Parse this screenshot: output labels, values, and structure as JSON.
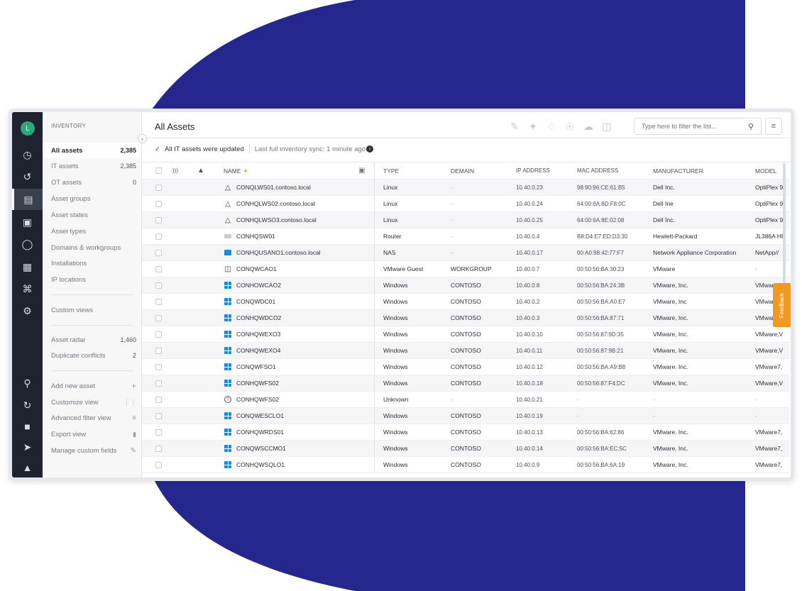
{
  "user": {
    "avatar_letter": "L"
  },
  "sidebar": {
    "title": "INVENTORY",
    "items": [
      {
        "label": "All assets",
        "count": "2,385",
        "active": true
      },
      {
        "label": "IT assets",
        "count": "2,385"
      },
      {
        "label": "OT assets",
        "count": "0"
      },
      {
        "label": "Asset groups",
        "count": ""
      },
      {
        "label": "Asset states",
        "count": ""
      },
      {
        "label": "Asset types",
        "count": ""
      },
      {
        "label": "Domains & workgroups",
        "count": ""
      },
      {
        "label": "Installations",
        "count": ""
      },
      {
        "label": "IP locations",
        "count": ""
      }
    ],
    "custom_views_label": "Custom views",
    "asset_radar": {
      "label": "Asset radar",
      "count": "1,460"
    },
    "duplicate_conflicts": {
      "label": "Duplicate conflicts",
      "count": "2"
    },
    "actions": [
      {
        "label": "Add new asset",
        "icon": "plus-icon"
      },
      {
        "label": "Customize view",
        "icon": "sliders-icon"
      },
      {
        "label": "Advanced filter view",
        "icon": "filter-lines-icon"
      },
      {
        "label": "Export view",
        "icon": "file-icon"
      },
      {
        "label": "Manage custom fields",
        "icon": "pencil-icon"
      }
    ]
  },
  "header": {
    "title": "All Assets",
    "filter_placeholder": "Type here to filter the list..."
  },
  "status": {
    "updated": "All IT assets were updated",
    "sync": "Last full inventory sync: 1 minute ago"
  },
  "table": {
    "columns": {
      "name": "NAME",
      "type": "TYPE",
      "domain": "DEMAIN",
      "ip": "IP ADDRESS",
      "mac": "MAC ADDRESS",
      "manufacturer": "MANUFACTURER",
      "model": "MODEL"
    },
    "rows": [
      {
        "icon": "linux-icon",
        "name": "CONQLWS01.contoso.local",
        "type": "Linux",
        "domain": "-",
        "ip": "10.40.0.23",
        "mac": "98:90:96:CE:61:B5",
        "manufacturer": "Dell Inc.",
        "model": "OptiPlex 9"
      },
      {
        "icon": "linux-icon",
        "name": "CONHQLWS02.contoso.local",
        "type": "Linux",
        "domain": "-",
        "ip": "10.40.0.24",
        "mac": "64:00:6A:8D:F8:0C",
        "manufacturer": "Dell Ine",
        "model": "OptiPlex 9"
      },
      {
        "icon": "linux-icon",
        "name": "CONHQLWSO3.contoso.local",
        "type": "Linux",
        "domain": "-",
        "ip": "10.40.0.25",
        "mac": "64:00:6A:8E:02:08",
        "manufacturer": "Dell Inc.",
        "model": "OptiPlex 9"
      },
      {
        "icon": "router-icon",
        "name": "CONHQSW01",
        "type": "Router",
        "domain": "-",
        "ip": "10.40.0.4",
        "mac": "B8:D4:E7:ED:D3:30",
        "manufacturer": "Hewlett-Packard",
        "model": "JL386A HF"
      },
      {
        "icon": "nas-icon",
        "name": "CONHQUSANO1.contoso.local",
        "type": "NAS",
        "domain": "-",
        "ip": "10.40.0.17",
        "mac": "00:A0:98:42:77:F7",
        "manufacturer": "Network Appliance Corporation",
        "model": "NetApp//"
      },
      {
        "icon": "vmware-icon",
        "name": "CONQWCAO1",
        "type": "VMware Guest",
        "domain": "WORKGROUP",
        "ip": "10.40.0.7",
        "mac": "00:50:56:BA:30:23",
        "manufacturer": "VMware",
        "model": "-"
      },
      {
        "icon": "windows-icon",
        "name": "CONHOWCAO2",
        "type": "Windows",
        "domain": "CONTOSO",
        "ip": "10.40.0.8",
        "mac": "00:50:56:BA:24:3B",
        "manufacturer": "VMware, Inc.",
        "model": "VMwar"
      },
      {
        "icon": "windows-icon",
        "name": "CONQWDC01",
        "type": "Windows",
        "domain": "CONTOSO",
        "ip": "10.40.0.2",
        "mac": "00:50:56:BA:A0:E7",
        "manufacturer": "VMware, Inc",
        "model": "VMwar"
      },
      {
        "icon": "windows-icon",
        "name": "CONHQWDCO2",
        "type": "Windows",
        "domain": "CONTOSO",
        "ip": "10.40.0.3",
        "mac": "00:50:56:BA:87:71",
        "manufacturer": "VMware, Inc.",
        "model": "VMwar"
      },
      {
        "icon": "windows-icon",
        "name": "CONHQWEXO3",
        "type": "Windows",
        "domain": "CONTOSO",
        "ip": "10.40.0.10",
        "mac": "00:50:56:87:9D:35",
        "manufacturer": "VMware, Inc.",
        "model": "VMware,V"
      },
      {
        "icon": "windows-icon",
        "name": "CONHQWEXO4",
        "type": "Windows",
        "domain": "CONTOSO",
        "ip": "10.40.0.11",
        "mac": "00:50:56:87:9B:21",
        "manufacturer": "VMware, Inc.",
        "model": "VMware,V"
      },
      {
        "icon": "windows-icon",
        "name": "CONQWFSO1",
        "type": "Windows",
        "domain": "CONTOSO",
        "ip": "10.40.0.12",
        "mac": "00:50:56:BA:A9:B8",
        "manufacturer": "VMware. Inc.",
        "model": "VMware7,"
      },
      {
        "icon": "windows-icon",
        "name": "CONHQWFS02",
        "type": "Windows",
        "domain": "CONTOSO",
        "ip": "10.40.0.18",
        "mac": "00:50:56:87:F4;DC",
        "manufacturer": "VMware, Inc.",
        "model": "VMware,V"
      },
      {
        "icon": "unknown-icon",
        "name": "CONHQWFS02",
        "type": "Unknown",
        "domain": "-",
        "ip": "10.40.0.21",
        "mac": "-",
        "manufacturer": "-",
        "model": "-"
      },
      {
        "icon": "windows-icon",
        "name": "CONQWESCLO1",
        "type": "Windows",
        "domain": "CONTOSO",
        "ip": "10.40.0.19",
        "mac": "-",
        "manufacturer": "-",
        "model": "-"
      },
      {
        "icon": "windows-icon",
        "name": "CONHQWRDS01",
        "type": "Windows",
        "domain": "CONTOSO",
        "ip": "10.40.0.13",
        "mac": "00:50:56:BA:62:86",
        "manufacturer": "VMware. Inc.",
        "model": "VMware7,"
      },
      {
        "icon": "windows-icon",
        "name": "CONQWSCCMO1",
        "type": "Windows",
        "domain": "CONTOSO",
        "ip": "10.40.0.14",
        "mac": "00:50:56:BA:EC:5C",
        "manufacturer": "VMware. Inc.",
        "model": "VMware7,"
      },
      {
        "icon": "windows-icon",
        "name": "CONHQWSQLO1",
        "type": "Windows",
        "domain": "CONTOSO",
        "ip": "10.40.0.9",
        "mac": "00:50:56:BA:6A:19",
        "manufacturer": "VMware, Inc.",
        "model": "VMware7,"
      }
    ]
  },
  "feedback_label": "Feedback",
  "colors": {
    "background_shape": "#25278f",
    "icon_bar": "#1e232d",
    "avatar": "#2ea87a",
    "feedback": "#f29a1f",
    "windows": "#1c8ad6"
  }
}
